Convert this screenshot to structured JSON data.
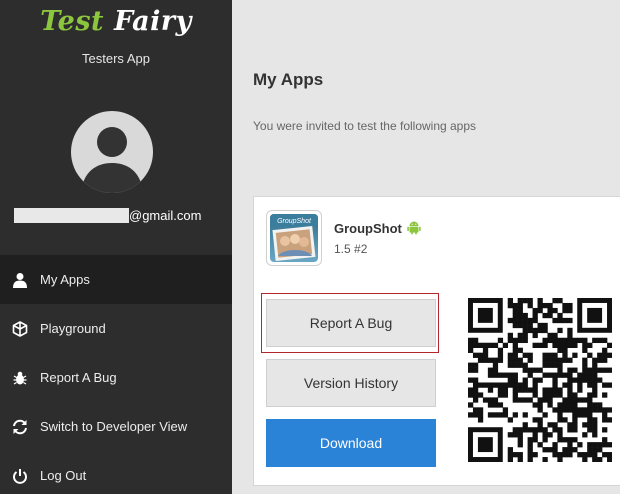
{
  "sidebar": {
    "logo_test": "Test",
    "logo_fairy": "Fairy",
    "subtitle": "Testers App",
    "email_suffix": "@gmail.com",
    "items": [
      {
        "label": "My Apps",
        "icon": "user-icon",
        "active": true
      },
      {
        "label": "Playground",
        "icon": "cube-icon",
        "active": false
      },
      {
        "label": "Report A Bug",
        "icon": "bug-icon",
        "active": false
      },
      {
        "label": "Switch to Developer View",
        "icon": "refresh-icon",
        "active": false
      },
      {
        "label": "Log Out",
        "icon": "power-icon",
        "active": false
      }
    ]
  },
  "main": {
    "title": "My Apps",
    "subtitle": "You were invited to test the following apps",
    "app": {
      "icon_label": "GroupShot",
      "name": "GroupShot",
      "platform_icon": "android-icon",
      "version": "1.5 #2",
      "buttons": {
        "report": "Report A Bug",
        "history": "Version History",
        "download": "Download"
      }
    }
  },
  "colors": {
    "sidebar_bg": "#2d2d2d",
    "active_item_bg": "#1f1f1f",
    "brand_green": "#8cc63f",
    "download_blue": "#2b83d8",
    "focus_red": "#b3262c",
    "android_green": "#8cc63f"
  }
}
